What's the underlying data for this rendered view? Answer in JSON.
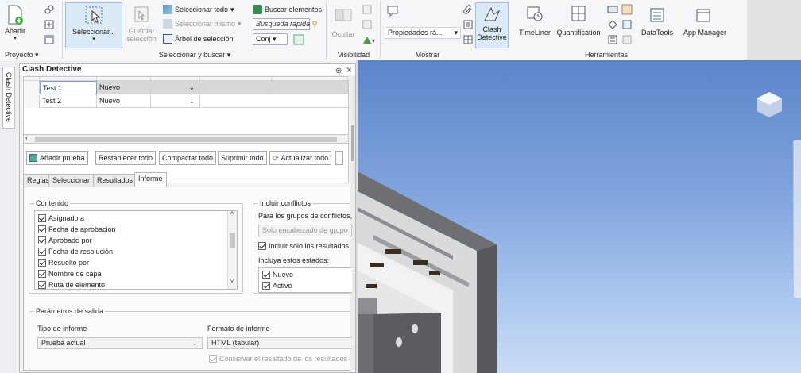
{
  "ribbon": {
    "buttons": {
      "anadir": "Añadir",
      "seleccionar": "Seleccionar...",
      "guardar_line1": "Guardar",
      "guardar_line2": "selección",
      "ocultar": "Ocultar",
      "propiedades": "Propiedades rá...",
      "clash_line1": "Clash",
      "clash_line2": "Detective",
      "timeliner": "TimeLiner",
      "quantification": "Quantification",
      "datatools": "DataTools",
      "appmanager": "App Manager"
    },
    "small": {
      "seleccionar_todo": "Seleccionar todo",
      "seleccionar_mismo": "Seleccionar mismo",
      "arbol": "Árbol de selección",
      "buscar": "Buscar elementos",
      "busqueda_rapida": "Búsqueda rápida",
      "conj": "Conj"
    },
    "groups": {
      "proyecto": "Proyecto",
      "seleccionar": "Seleccionar y buscar",
      "visibilidad": "Visibilidad",
      "mostrar": "Mostrar",
      "herramientas": "Herramientas"
    }
  },
  "sidetab": "Clash Detective",
  "panel": {
    "title": "Clash Detective",
    "pin": "⊕",
    "close": "×",
    "tests": [
      {
        "name": "Test 1",
        "status": "Nuevo"
      },
      {
        "name": "Test 2",
        "status": "Nuevo"
      }
    ],
    "buttons": {
      "anadir_prueba": "Añadir prueba",
      "restablecer": "Restablecer todo",
      "compactar": "Compactar todo",
      "suprimir": "Suprimir todo",
      "actualizar": "Actualizar todo"
    },
    "tabs": [
      "Reglas",
      "Seleccionar",
      "Resultados",
      "Informe"
    ],
    "contenido": {
      "legend": "Contenido",
      "items": [
        "Asignado a",
        "Fecha de aprobación",
        "Aprobado por",
        "Fecha de resolución",
        "Resuelto por",
        "Nombre de capa",
        "Ruta de elemento"
      ]
    },
    "incluir": {
      "legend": "Incluir conflictos",
      "para_grupos": "Para los grupos de conflictos,",
      "solo_encabezado": "Solo encabezado de grupo",
      "incluir_solo": "Incluir solo los resultados",
      "incluya_estados": "Incluya estos estados:",
      "estados": [
        "Nuevo",
        "Activo"
      ]
    },
    "salida": {
      "legend": "Parámetros de salida",
      "tipo_label": "Tipo de informe",
      "tipo_value": "Prueba actual",
      "formato_label": "Formato de informe",
      "formato_value": "HTML (tabular)",
      "conservar": "Conservar el resaltado de los resultados"
    }
  }
}
